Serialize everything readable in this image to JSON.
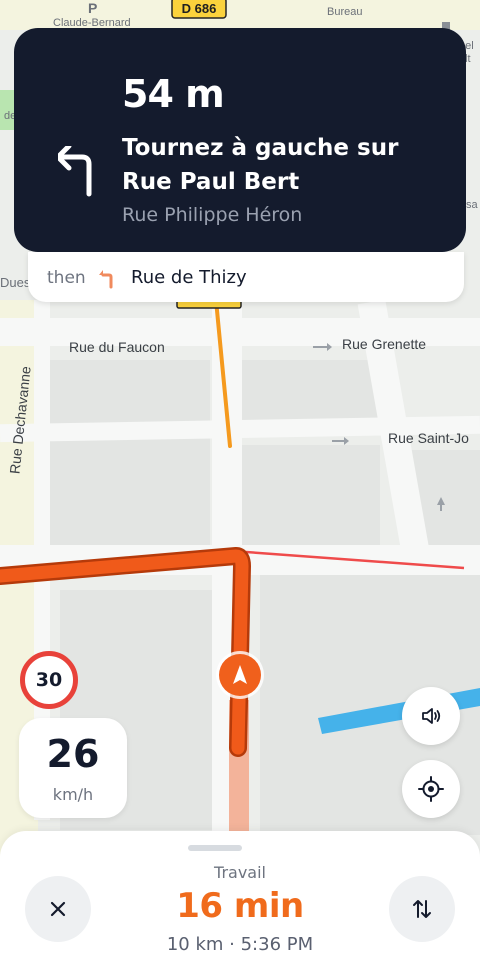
{
  "map": {
    "street_labels": {
      "rue_du_faucon": "Rue du Faucon",
      "rue_grenette": "Rue Grenette",
      "rue_saint_jo": "Rue Saint-Jo",
      "rue_dechavanne": "Rue Dechavanne",
      "claude_bernard": "Claude-Bernard",
      "bureau": "Bureau",
      "road_number": "D 686",
      "parking": "P",
      "dues": "Dues",
      "de_fragment": "de",
      "sa_fragment": "sa",
      "nel_fragment": "nel",
      "olt_fragment": "olt"
    },
    "colors": {
      "route": "#f05a1a",
      "route_outline": "#b53a0a",
      "traffic_orange": "#f59a1e",
      "traffic_red": "#ef4b4b",
      "water": "#45b2ea"
    }
  },
  "instruction": {
    "distance": "54 m",
    "text": "Tournez à gauche sur Rue Paul Bert",
    "toward": "Rue Philippe Héron",
    "icon": "turn-left-icon"
  },
  "next_instruction": {
    "then_label": "then",
    "street": "Rue de Thizy",
    "icon": "turn-left-small-icon"
  },
  "speed": {
    "limit": "30",
    "current": "26",
    "unit": "km/h"
  },
  "controls": {
    "sound_icon": "speaker-icon",
    "recenter_icon": "crosshair-icon"
  },
  "trip": {
    "destination": "Travail",
    "eta": "16 min",
    "info": "10 km · 5:36 PM",
    "close_icon": "close-icon",
    "routes_icon": "swap-vertical-icon"
  }
}
